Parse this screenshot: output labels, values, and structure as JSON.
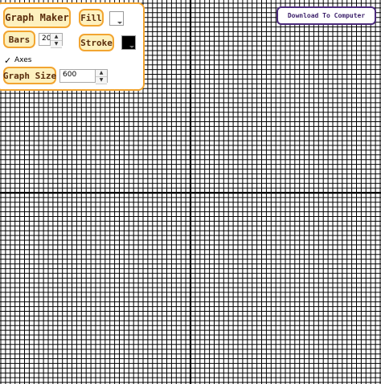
{
  "graph": {
    "bars": 20,
    "axes": true,
    "grid_color": "#000000",
    "axis_color": "#000000"
  },
  "panel": {
    "title_button": "Graph Maker",
    "fill_button": "Fill",
    "fill_color": "#ffffff",
    "bars_button": "Bars",
    "bars_value": "20",
    "stroke_button": "Stroke",
    "stroke_color": "#000000",
    "axes_label": "Axes",
    "axes_checked": "✓",
    "graph_size_button": "Graph Size",
    "graph_size_value": "600"
  },
  "download_button": "Download To Computer",
  "colors": {
    "accent": "#f2a531",
    "button_bg": "#fdf1bf",
    "button_text": "#5a2d0c",
    "download_border": "#4b2a7c"
  },
  "icons": {
    "spin_up": "▲",
    "spin_down": "▼",
    "dropdown": "dropdown-triangle-icon"
  }
}
